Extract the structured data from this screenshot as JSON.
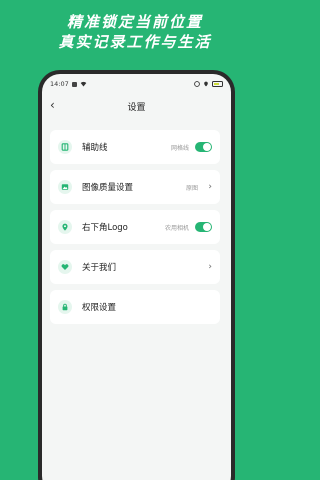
{
  "promo": {
    "line1": "精准锁定当前位置",
    "line2": "真实记录工作与生活"
  },
  "status": {
    "time": "14:07"
  },
  "nav": {
    "title": "设置",
    "back_icon": "chevron-left-icon"
  },
  "settings": [
    {
      "label": "辅助线",
      "value": "网格线",
      "control": "toggle",
      "on": true,
      "icon": "guide-lines-icon"
    },
    {
      "label": "图像质量设置",
      "value": "原图",
      "control": "chevron",
      "icon": "image-icon"
    },
    {
      "label": "右下角Logo",
      "value": "农用相机",
      "control": "toggle",
      "on": true,
      "icon": "location-pin-icon"
    },
    {
      "label": "关于我们",
      "value": "",
      "control": "chevron",
      "icon": "heart-icon"
    },
    {
      "label": "权限设置",
      "value": "",
      "control": "none",
      "icon": "lock-icon"
    }
  ],
  "colors": {
    "accent": "#26b574",
    "background": "#26b574",
    "screen": "#f4f6f5"
  }
}
